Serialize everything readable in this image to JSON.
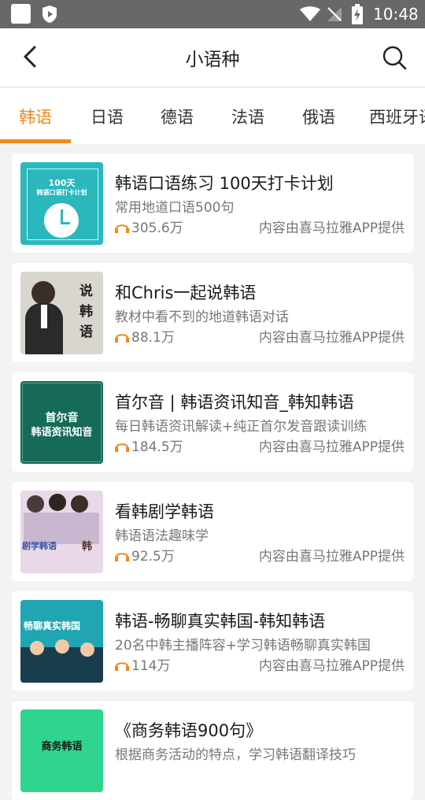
{
  "status_bar": {
    "time": "10:48"
  },
  "header": {
    "title": "小语种"
  },
  "tabs": [
    {
      "label": "韩语"
    },
    {
      "label": "日语"
    },
    {
      "label": "德语"
    },
    {
      "label": "法语"
    },
    {
      "label": "俄语"
    },
    {
      "label": "西班牙语"
    }
  ],
  "items": [
    {
      "title": "韩语口语练习 100天打卡计划",
      "subtitle": "常用地道口语500句",
      "plays": "305.6万",
      "source": "内容由喜马拉雅APP提供",
      "cover": {
        "bg": "#2ab8bd",
        "l1": "100天",
        "l2": "韩语口语打卡计划"
      }
    },
    {
      "title": "和Chris一起说韩语",
      "subtitle": "教材中看不到的地道韩语对话",
      "plays": "88.1万",
      "source": "内容由喜马拉雅APP提供",
      "cover": {
        "bg": "#d9d6cf",
        "l1": "说",
        "l2": "韩",
        "l3": "语"
      }
    },
    {
      "title": "首尔音 | 韩语资讯知音_韩知韩语",
      "subtitle": "每日韩语资讯解读+纯正首尔发音跟读训练",
      "plays": "184.5万",
      "source": "内容由喜马拉雅APP提供",
      "cover": {
        "bg": "#166a58",
        "l1": "首尔音",
        "l2": "韩语资讯知音"
      }
    },
    {
      "title": "看韩剧学韩语",
      "subtitle": "韩语语法趣味学",
      "plays": "92.5万",
      "source": "内容由喜马拉雅APP提供",
      "cover": {
        "bg": "#e8d8e8",
        "l1": "剧学韩语",
        "l2": "韩"
      }
    },
    {
      "title": "韩语-畅聊真实韩国-韩知韩语",
      "subtitle": "20名中韩主播阵容+学习韩语畅聊真实韩国",
      "plays": "114万",
      "source": "内容由喜马拉雅APP提供",
      "cover": {
        "bg": "#1fa6b2",
        "l1": "畅聊真实韩国"
      }
    },
    {
      "title": "《商务韩语900句》",
      "subtitle": "根据商务活动的特点，学习韩语翻译技巧",
      "plays": "",
      "source": "",
      "cover": {
        "bg": "#2fd48e",
        "l1": "商务韩语"
      }
    }
  ],
  "colors": {
    "accent": "#f08a1a"
  }
}
